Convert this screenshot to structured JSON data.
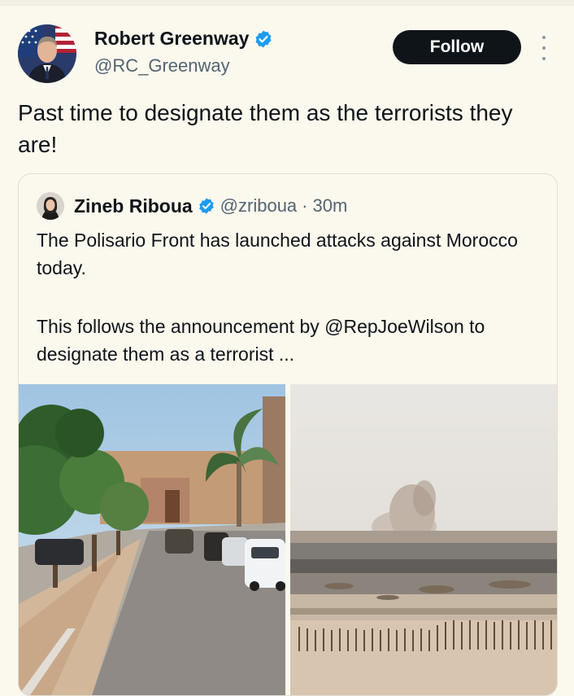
{
  "author": {
    "name": "Robert Greenway",
    "handle": "@RC_Greenway",
    "verified": true
  },
  "follow_label": "Follow",
  "tweet_text": "Past time to designate them as the terrorists they are!",
  "quote": {
    "name": "Zineb Riboua",
    "handle": "@zriboua",
    "separator": "·",
    "time": "30m",
    "verified": true,
    "paragraph1": "The Polisario Front has launched attacks against Morocco today.",
    "paragraph2": "This follows the announcement by @RepJoeWilson to designate them as a terrorist ..."
  },
  "colors": {
    "background": "#fbf8ee",
    "verified_badge": "#1d9bf0",
    "follow_button": "#0f1419",
    "secondary_text": "#536471"
  }
}
